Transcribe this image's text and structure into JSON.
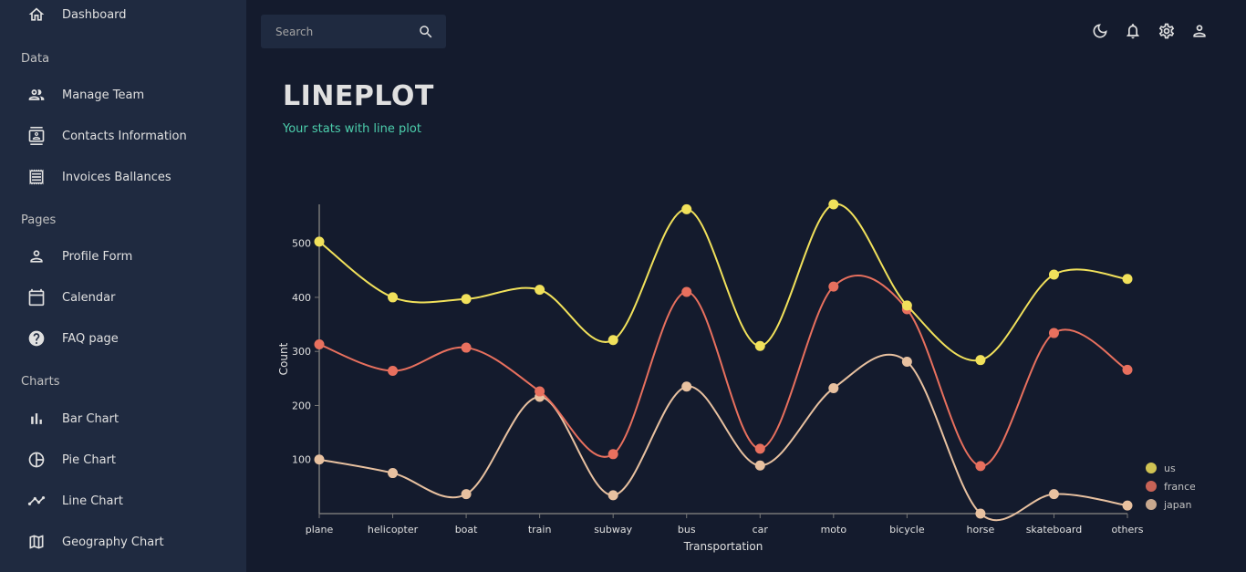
{
  "sidebar": {
    "top_item": {
      "label": "Dashboard",
      "icon": "home-icon"
    },
    "sections": [
      {
        "title": "Data",
        "items": [
          {
            "label": "Manage Team",
            "icon": "people-icon"
          },
          {
            "label": "Contacts Information",
            "icon": "contacts-icon"
          },
          {
            "label": "Invoices Ballances",
            "icon": "receipt-icon"
          }
        ]
      },
      {
        "title": "Pages",
        "items": [
          {
            "label": "Profile Form",
            "icon": "person-icon"
          },
          {
            "label": "Calendar",
            "icon": "calendar-icon"
          },
          {
            "label": "FAQ page",
            "icon": "help-icon"
          }
        ]
      },
      {
        "title": "Charts",
        "items": [
          {
            "label": "Bar Chart",
            "icon": "bar-chart-icon"
          },
          {
            "label": "Pie Chart",
            "icon": "pie-chart-icon"
          },
          {
            "label": "Line Chart",
            "icon": "timeline-icon"
          },
          {
            "label": "Geography Chart",
            "icon": "map-icon"
          }
        ]
      }
    ]
  },
  "topbar": {
    "search_placeholder": "Search",
    "icons": [
      "dark-mode-icon",
      "notifications-icon",
      "settings-icon",
      "person-icon"
    ]
  },
  "header": {
    "title": "LINEPLOT",
    "subtitle": "Your stats with line plot"
  },
  "colors": {
    "background": "#141b2d",
    "sidebar": "#1f2a40",
    "accent": "#4cceac",
    "us": "#f1e15b",
    "france": "#e8705e",
    "japan": "#e8c1a0"
  },
  "chart_data": {
    "type": "line",
    "categories": [
      "plane",
      "helicopter",
      "boat",
      "train",
      "subway",
      "bus",
      "car",
      "moto",
      "bicycle",
      "horse",
      "skateboard",
      "others"
    ],
    "series": [
      {
        "name": "us",
        "color": "#f1e15b",
        "values": [
          503,
          400,
          397,
          414,
          321,
          563,
          310,
          572,
          385,
          284,
          442,
          434
        ]
      },
      {
        "name": "france",
        "color": "#e8705e",
        "values": [
          313,
          264,
          307,
          226,
          110,
          410,
          120,
          420,
          378,
          88,
          334,
          266
        ]
      },
      {
        "name": "japan",
        "color": "#e8c1a0",
        "values": [
          100,
          75,
          36,
          216,
          34,
          235,
          89,
          232,
          281,
          0,
          36,
          15
        ]
      }
    ],
    "xlabel": "Transportation",
    "ylabel": "Count",
    "yticks": [
      100,
      200,
      300,
      400,
      500
    ],
    "ylim": [
      0,
      572
    ],
    "grid": false,
    "legend": "bottom-right"
  }
}
